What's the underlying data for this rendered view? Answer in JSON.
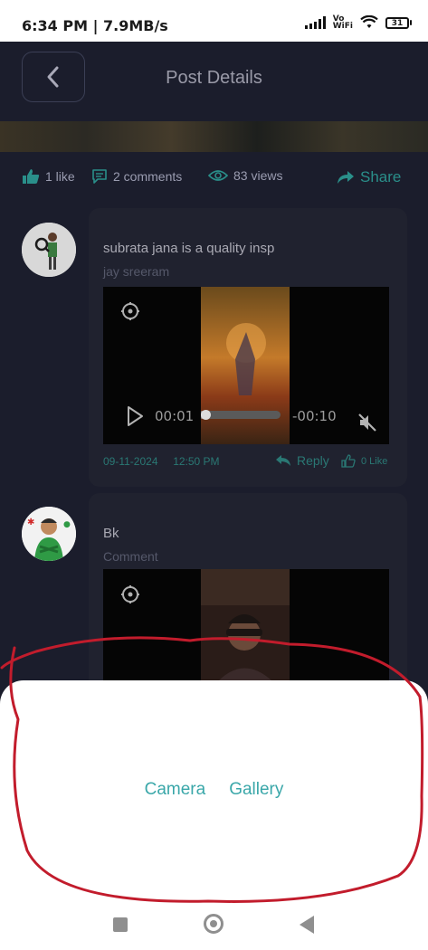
{
  "status_bar": {
    "time": "6:34 PM | 7.9MB/s",
    "volte": "Vo",
    "wifi_label": "WiFi",
    "battery": "31"
  },
  "header": {
    "title": "Post Details"
  },
  "stats": {
    "likes": "1 like",
    "comments": "2 comments",
    "views": "83 views",
    "share": "Share"
  },
  "comments": [
    {
      "name": "subrata jana is a quality insp",
      "text": "jay sreeram",
      "video": {
        "elapsed": "00:01",
        "remaining": "-00:10",
        "progress": 0.03
      },
      "date": "09-11-2024",
      "time": "12:50 PM",
      "reply_label": "Reply",
      "likes": "0 Like"
    },
    {
      "name": "Bk",
      "text": "Comment"
    }
  ],
  "sheet": {
    "camera": "Camera",
    "gallery": "Gallery"
  },
  "colors": {
    "background": "#1b1d2c",
    "accent": "#3aa7a9",
    "muted_accent": "#2a7874",
    "annotation": "#c21c2c"
  }
}
